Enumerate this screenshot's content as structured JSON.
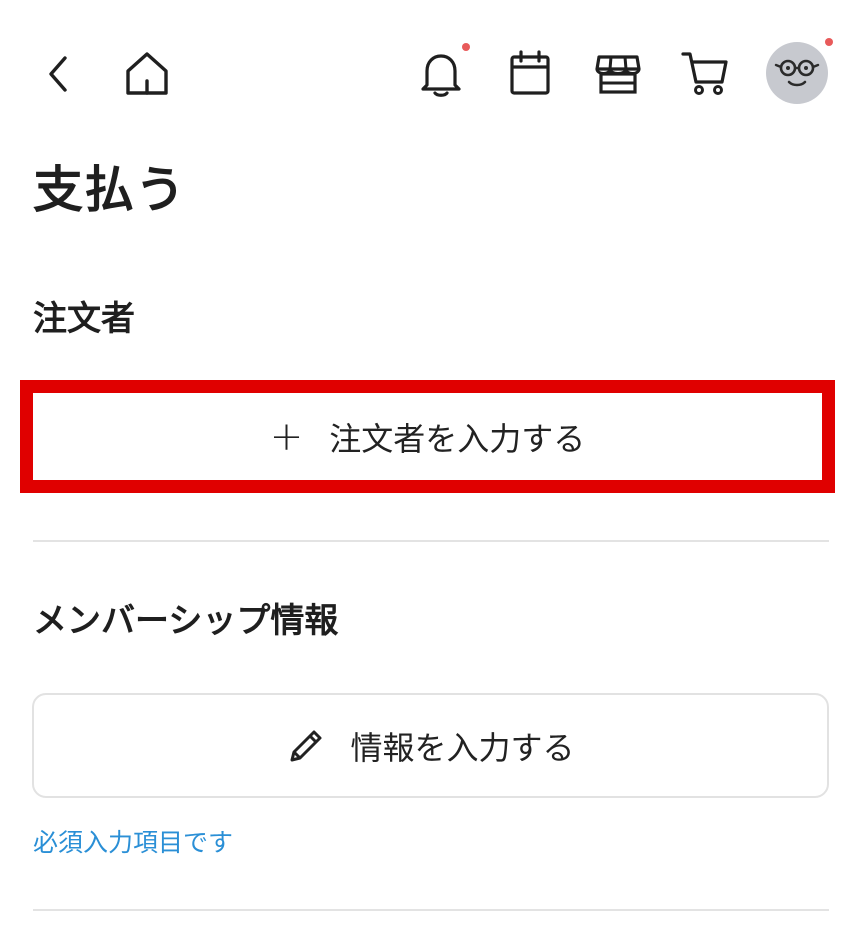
{
  "header": {
    "icons": [
      "chevron-left-icon",
      "home-icon",
      "bell-icon",
      "calendar-icon",
      "store-icon",
      "cart-icon",
      "avatar"
    ],
    "notification_dot_color": "#e85a5a"
  },
  "main": {
    "title": "支払う",
    "orderer_section": {
      "title": "注文者",
      "add_button_label": "注文者を入力する",
      "add_button_icon": "+"
    },
    "membership_section": {
      "title": "メンバーシップ情報",
      "enter_info_label": "情報を入力する",
      "required_note": "必須入力項目です"
    }
  },
  "colors": {
    "highlight_border": "#e00000",
    "link_blue": "#2a8fd6",
    "text": "#1f1f1f",
    "divider": "#e3e3e3"
  }
}
